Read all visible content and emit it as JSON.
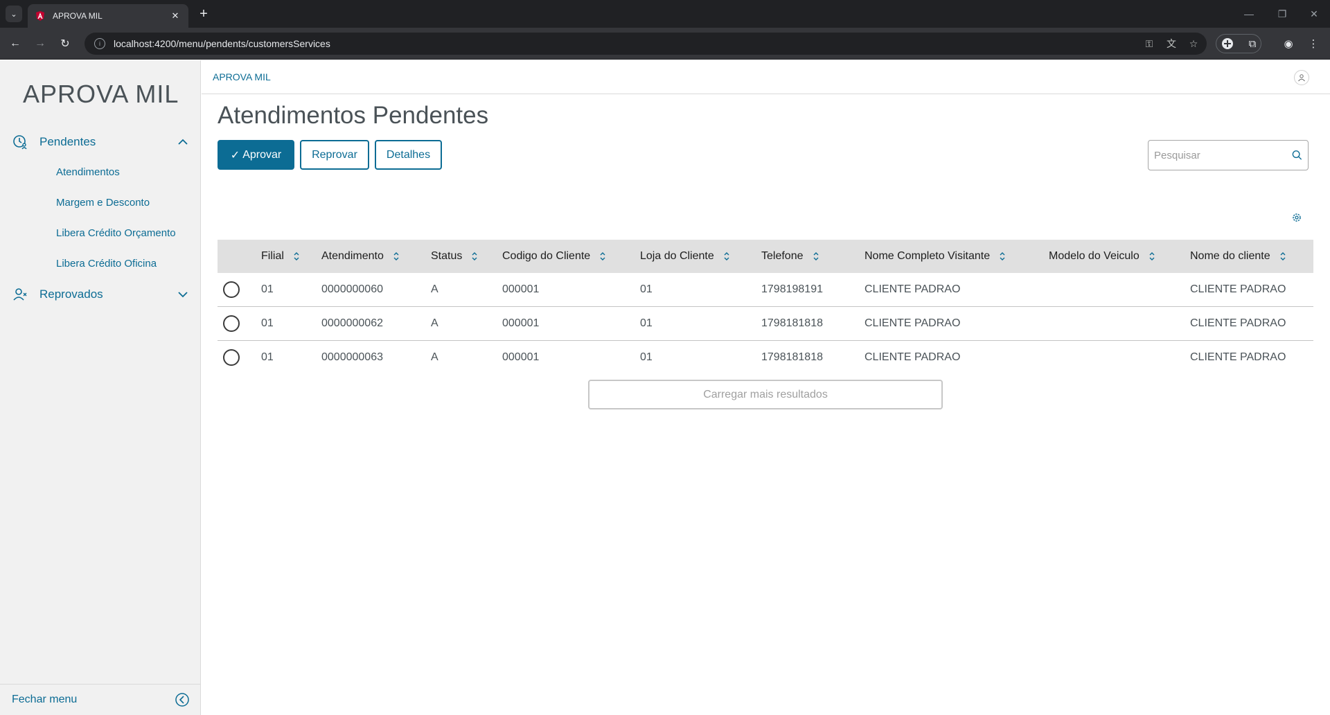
{
  "browser": {
    "tab_title": "APROVA MIL",
    "url": "localhost:4200/menu/pendents/customersServices"
  },
  "app": {
    "brand": "APROVA MIL",
    "breadcrumb": "APROVA MIL"
  },
  "sidebar": {
    "groups": [
      {
        "label": "Pendentes",
        "icon": "clock-user-icon",
        "expanded": true,
        "items": [
          {
            "label": "Atendimentos"
          },
          {
            "label": "Margem e Desconto"
          },
          {
            "label": "Libera Crédito Orçamento"
          },
          {
            "label": "Libera Crédito Oficina"
          }
        ]
      },
      {
        "label": "Reprovados",
        "icon": "user-x-icon",
        "expanded": false,
        "items": []
      }
    ],
    "footer_label": "Fechar menu"
  },
  "page": {
    "title": "Atendimentos Pendentes",
    "actions": {
      "approve": "Aprovar",
      "reject": "Reprovar",
      "details": "Detalhes"
    },
    "search_placeholder": "Pesquisar",
    "load_more": "Carregar mais resultados"
  },
  "table": {
    "columns": [
      "Filial",
      "Atendimento",
      "Status",
      "Codigo do Cliente",
      "Loja do Cliente",
      "Telefone",
      "Nome Completo Visitante",
      "Modelo do Veiculo",
      "Nome do cliente"
    ],
    "rows": [
      [
        "01",
        "0000000060",
        "A",
        "000001",
        "01",
        "1798198191",
        "CLIENTE PADRAO",
        "",
        "CLIENTE PADRAO"
      ],
      [
        "01",
        "0000000062",
        "A",
        "000001",
        "01",
        "1798181818",
        "CLIENTE PADRAO",
        "",
        "CLIENTE PADRAO"
      ],
      [
        "01",
        "0000000063",
        "A",
        "000001",
        "01",
        "1798181818",
        "CLIENTE PADRAO",
        "",
        "CLIENTE PADRAO"
      ]
    ]
  },
  "colors": {
    "primary": "#0c6c94",
    "sidebar_bg": "#f1f1f1",
    "header_bg": "#e0e0e0"
  }
}
